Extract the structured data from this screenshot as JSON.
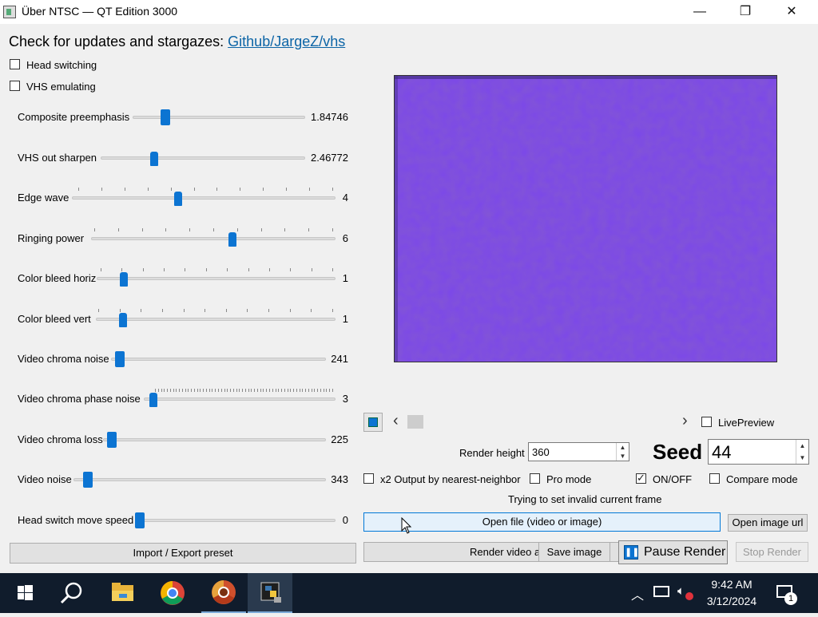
{
  "window": {
    "title": "Über NTSC — QT Edition 3000",
    "minimize_glyph": "—",
    "maximize_glyph": "❐",
    "close_glyph": "✕"
  },
  "header": {
    "prefix": "Check for updates and stargazes: ",
    "link_text": "Github/JargeZ/vhs"
  },
  "toggles": {
    "head_switching": "Head switching",
    "vhs_emulating": "VHS emulating"
  },
  "sliders": [
    {
      "label": "Composite preemphasis",
      "value": "1.84746",
      "fraction": 0.17
    },
    {
      "label": "VHS out sharpen",
      "value": "2.46772",
      "fraction": 0.25
    },
    {
      "label": "Edge wave",
      "value": "4",
      "fraction": 0.4
    },
    {
      "label": "Ringing power",
      "value": "6",
      "fraction": 0.58
    },
    {
      "label": "Color bleed horiz",
      "value": "1",
      "fraction": 0.1
    },
    {
      "label": "Color bleed vert",
      "value": "1",
      "fraction": 0.1
    },
    {
      "label": "Video chroma noise",
      "value": "241",
      "fraction": 0.02
    },
    {
      "label": "Video chroma phase noise",
      "value": "3",
      "fraction": 0.03
    },
    {
      "label": "Video chroma loss",
      "value": "225",
      "fraction": 0.02
    },
    {
      "label": "Video noise",
      "value": "343",
      "fraction": 0.04
    },
    {
      "label": "Head switch move speed",
      "value": "0",
      "fraction": 0.0
    }
  ],
  "buttons": {
    "import_export": "Import / Export preset",
    "open_file": "Open file (video or image)",
    "open_image_url": "Open image url",
    "render_video": "Render video a",
    "save_image": "Save image",
    "pause_render": "Pause Render",
    "stop_render": "Stop Render"
  },
  "timeline": {
    "left_arrow": "‹",
    "right_arrow": "›"
  },
  "options": {
    "live_preview": "LivePreview",
    "render_height_label": "Render height",
    "render_height_value": "360",
    "seed_label": "Seed",
    "seed_value": "44",
    "x2_output": "x2 Output by nearest-neighbor",
    "pro_mode": "Pro mode",
    "on_off": "ON/OFF",
    "compare_mode": "Compare mode"
  },
  "status": {
    "message": "Trying to set invalid current frame"
  },
  "colors": {
    "accent": "#0c74d2",
    "preview_purple": "#7a44e8",
    "taskbar": "#101c2c"
  },
  "taskbar": {
    "icons": [
      "windows-start-icon",
      "search-icon",
      "file-explorer-icon",
      "chrome-icon",
      "chrome-alt-icon",
      "python-app-icon"
    ],
    "time": "9:42 AM",
    "date": "3/12/2024",
    "notification_count": "1"
  }
}
